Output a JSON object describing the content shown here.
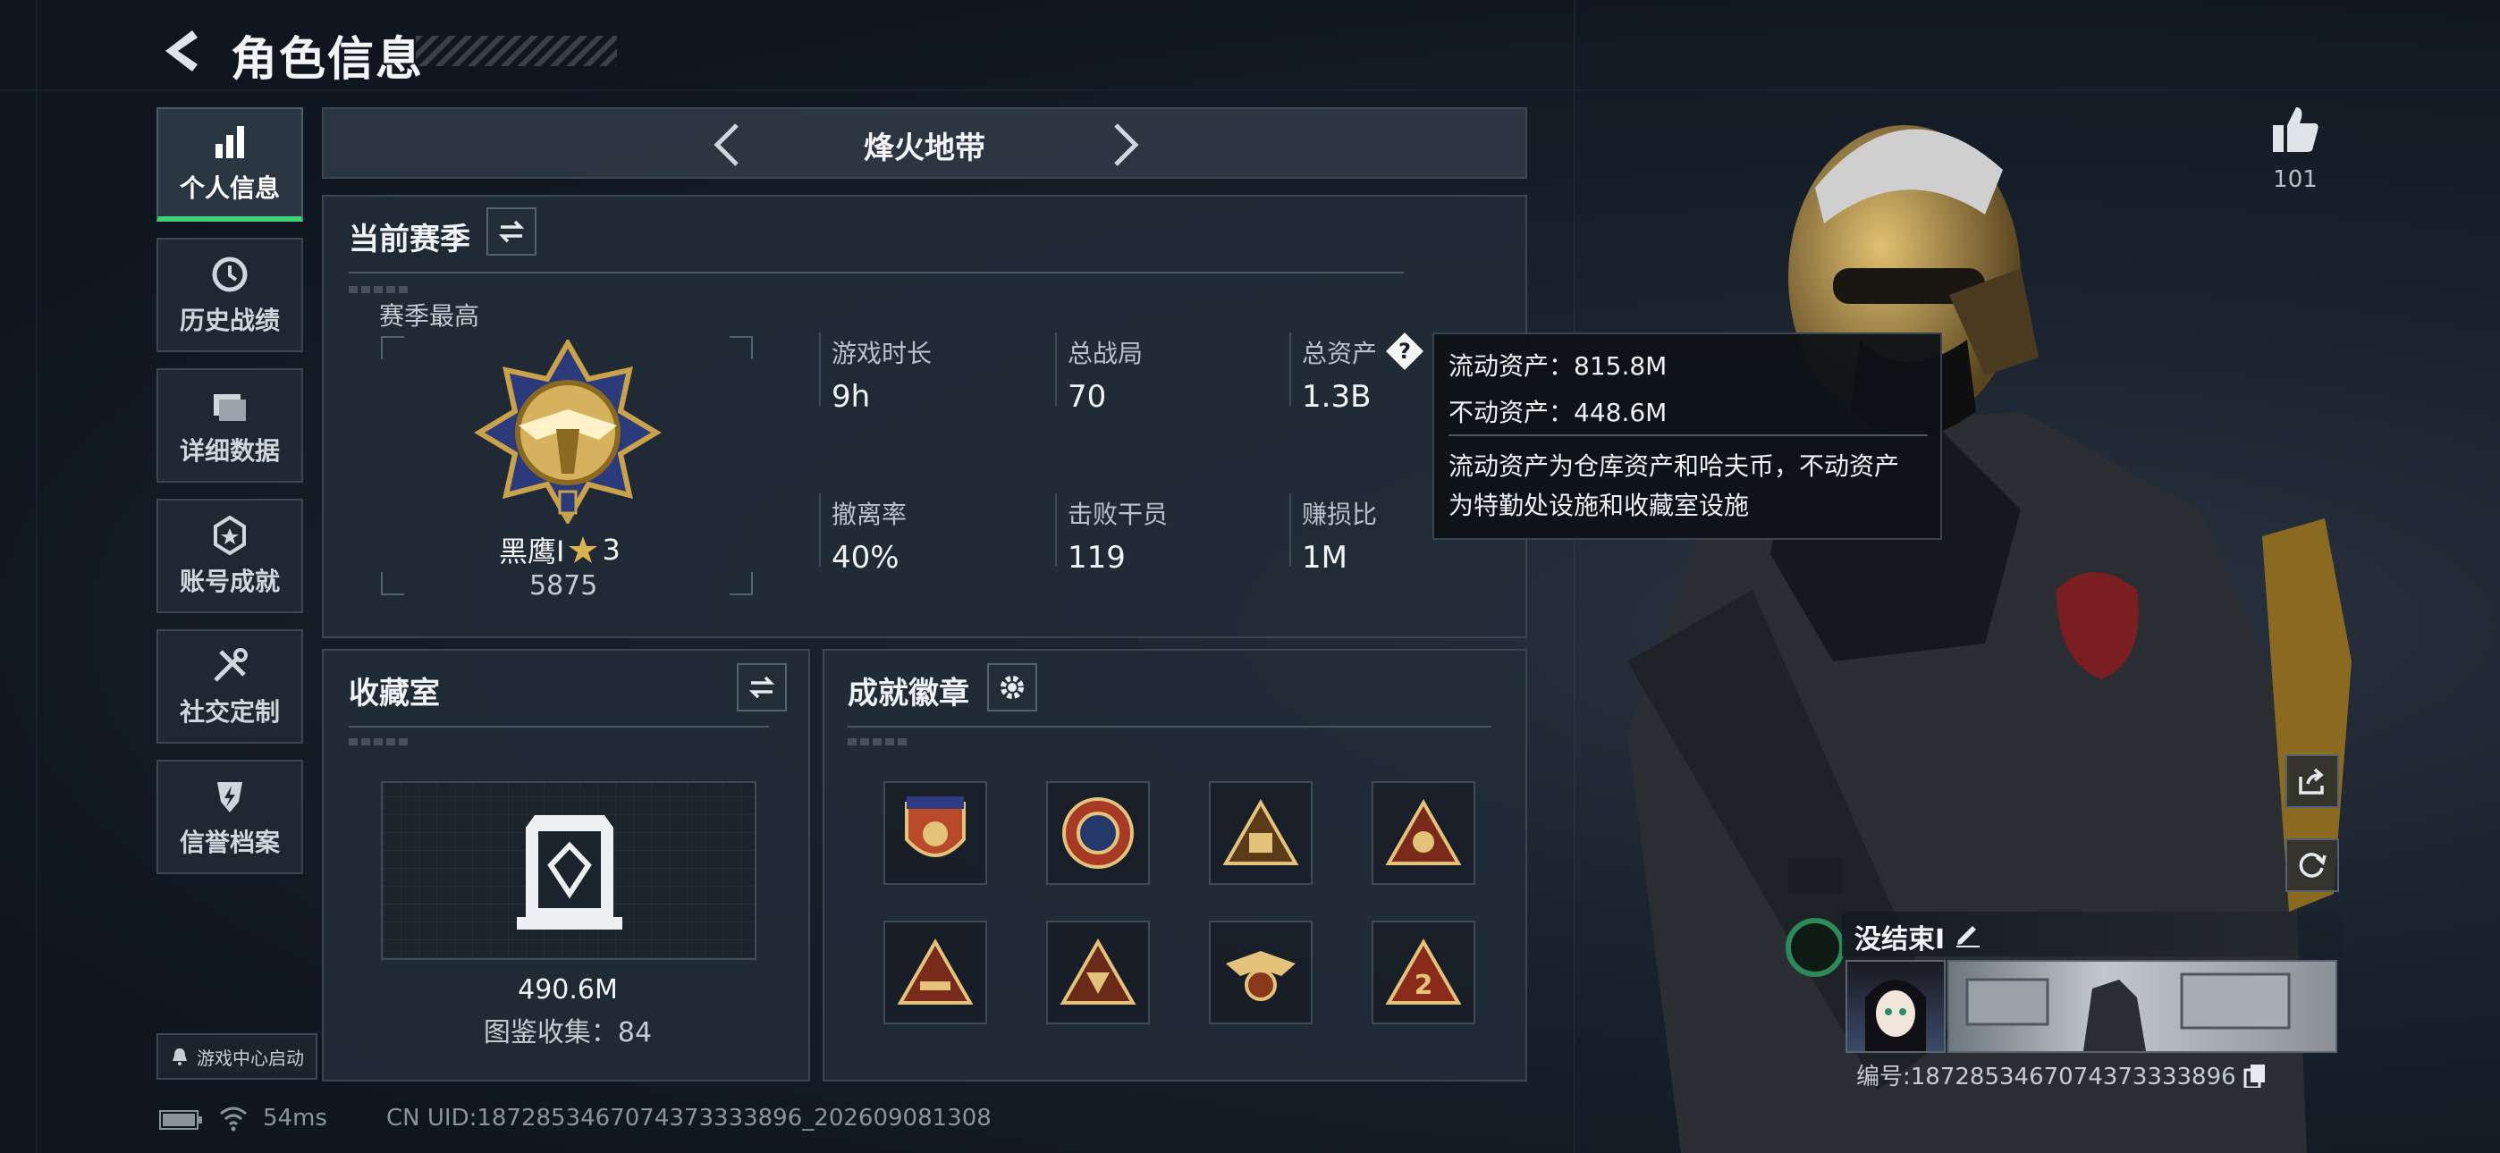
{
  "header": {
    "title": "角色信息"
  },
  "nav": [
    {
      "label": "个人信息",
      "icon": "bar-chart-icon",
      "active": true
    },
    {
      "label": "历史战绩",
      "icon": "history-icon"
    },
    {
      "label": "详细数据",
      "icon": "folder-icon"
    },
    {
      "label": "账号成就",
      "icon": "achievement-icon"
    },
    {
      "label": "社交定制",
      "icon": "tools-icon"
    },
    {
      "label": "信誉档案",
      "icon": "credit-icon"
    }
  ],
  "map_selector": {
    "name": "烽火地带"
  },
  "season": {
    "title": "当前赛季",
    "best_label": "赛季最高",
    "rank_name": "黑鹰I",
    "rank_stars": "3",
    "rank_score": "5875",
    "stats": [
      {
        "label": "游戏时长",
        "value": "9h"
      },
      {
        "label": "总战局",
        "value": "70"
      },
      {
        "label": "总资产",
        "value": "1.3B"
      },
      {
        "label": "撤离率",
        "value": "40%"
      },
      {
        "label": "击败干员",
        "value": "119"
      },
      {
        "label": "赚损比",
        "value": "1M"
      }
    ]
  },
  "tooltip": {
    "liquid": "流动资产：815.8M",
    "fixed": "不动资产：448.6M",
    "desc_line1": "流动资产为仓库资产和哈夫币，不动资产",
    "desc_line2": "为特勤处设施和收藏室设施"
  },
  "collection": {
    "title": "收藏室",
    "value": "490.6M",
    "catalog": "图鉴收集：84"
  },
  "achievements": {
    "title": "成就徽章"
  },
  "likes": {
    "count": "101"
  },
  "player": {
    "name": "没结束I",
    "id": "编号:1872853467074373333896"
  },
  "bottom": {
    "start_label": "游戏中心启动",
    "ping": "54ms",
    "uid": "CN UID:1872853467074373333896_202609081308"
  },
  "colors": {
    "accent_green": "#3fd07a",
    "gold": "#c9a24a"
  }
}
